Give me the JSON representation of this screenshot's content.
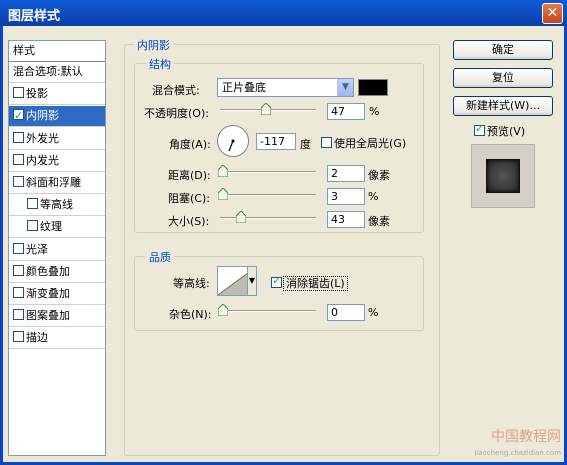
{
  "window": {
    "title": "图层样式",
    "close_label": "✕"
  },
  "sidebar": {
    "header": "样式",
    "items": [
      {
        "label": "混合选项:默认",
        "checkbox": false,
        "checked": false,
        "selected": false
      },
      {
        "label": "投影",
        "checkbox": true,
        "checked": false,
        "selected": false
      },
      {
        "label": "内阴影",
        "checkbox": true,
        "checked": true,
        "selected": true
      },
      {
        "label": "外发光",
        "checkbox": true,
        "checked": false,
        "selected": false
      },
      {
        "label": "内发光",
        "checkbox": true,
        "checked": false,
        "selected": false
      },
      {
        "label": "斜面和浮雕",
        "checkbox": true,
        "checked": false,
        "selected": false
      },
      {
        "label": "等高线",
        "checkbox": true,
        "checked": false,
        "selected": false
      },
      {
        "label": "纹理",
        "checkbox": true,
        "checked": false,
        "selected": false
      },
      {
        "label": "光泽",
        "checkbox": true,
        "checked": false,
        "selected": false
      },
      {
        "label": "颜色叠加",
        "checkbox": true,
        "checked": false,
        "selected": false
      },
      {
        "label": "渐变叠加",
        "checkbox": true,
        "checked": false,
        "selected": false
      },
      {
        "label": "图案叠加",
        "checkbox": true,
        "checked": false,
        "selected": false
      },
      {
        "label": "描边",
        "checkbox": true,
        "checked": false,
        "selected": false
      }
    ]
  },
  "inner_shadow": {
    "title": "内阴影",
    "structure": {
      "title": "结构",
      "blend_mode_label": "混合模式:",
      "blend_mode_value": "正片叠底",
      "shadow_color": "#000000",
      "opacity_label": "不透明度(O):",
      "opacity_value": "47",
      "opacity_unit": "%",
      "angle_label": "角度(A):",
      "angle_value": "-117",
      "angle_unit": "度",
      "global_light_label": "使用全局光(G)",
      "global_light_checked": false,
      "distance_label": "距离(D):",
      "distance_value": "2",
      "distance_unit": "像素",
      "choke_label": "阻塞(C):",
      "choke_value": "3",
      "choke_unit": "%",
      "size_label": "大小(S):",
      "size_value": "43",
      "size_unit": "像素"
    },
    "quality": {
      "title": "品质",
      "contour_label": "等高线:",
      "anti_alias_label": "消除锯齿(L)",
      "anti_alias_checked": true,
      "noise_label": "杂色(N):",
      "noise_value": "0",
      "noise_unit": "%"
    }
  },
  "buttons": {
    "ok": "确定",
    "reset": "复位",
    "new_style": "新建样式(W)...",
    "preview_label": "预览(V)",
    "preview_checked": true
  },
  "watermark": {
    "line1": "中国教程网",
    "line2": "jiaocheng.chazidian.com"
  }
}
